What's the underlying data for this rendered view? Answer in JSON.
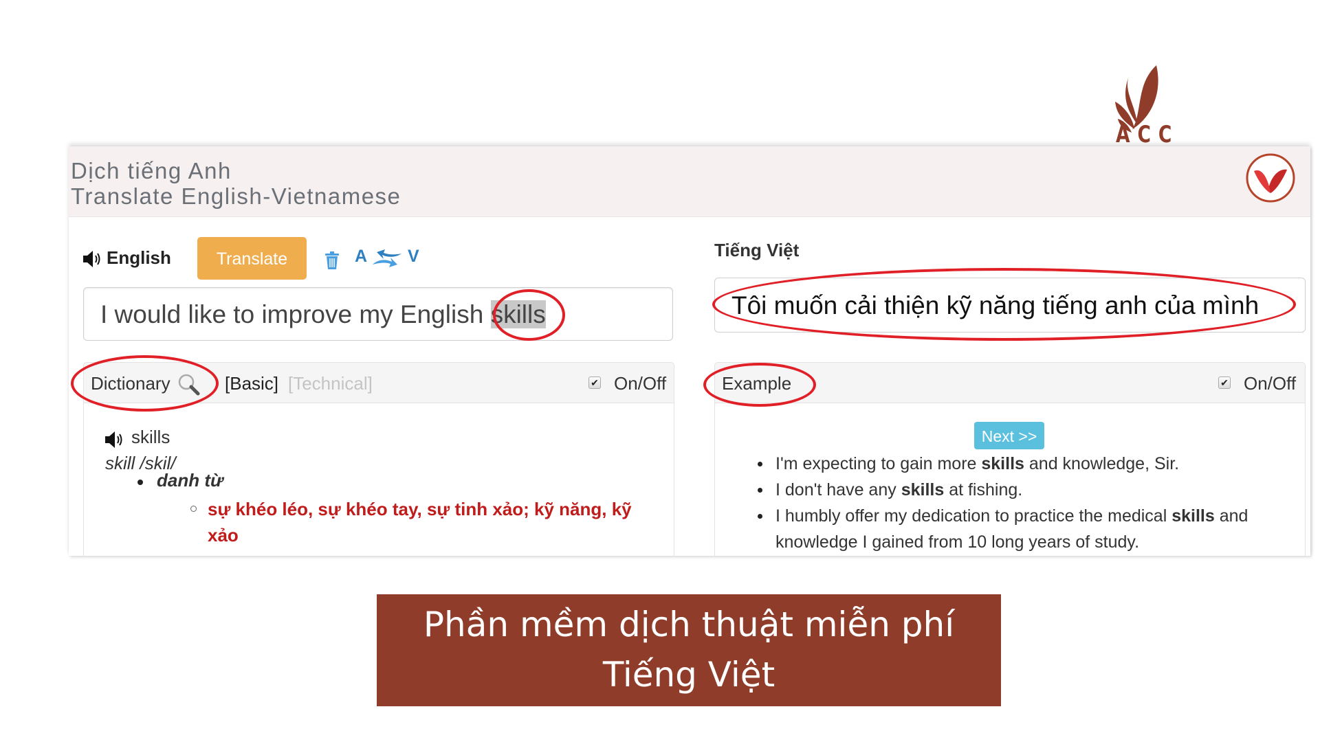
{
  "logo": {
    "text": "ACC",
    "color": "#8f3d2a"
  },
  "app": {
    "title_vi": "Dịch tiếng Anh",
    "title_en": "Translate English-Vietnamese",
    "brand_icon": "v-logo-icon"
  },
  "source": {
    "language_label": "English",
    "speaker_icon": "speaker-icon",
    "translate_button": "Translate",
    "trash_icon": "trash-icon",
    "swap": {
      "from": "A",
      "icon": "swap-arrows-icon",
      "to": "V"
    },
    "input_text_before": "I would like to improve my English ",
    "input_text_highlight": "skills"
  },
  "target": {
    "language_label": "Tiếng Việt",
    "output_text": "Tôi muốn cải thiện kỹ năng tiếng anh của mình"
  },
  "dictionary": {
    "label": "Dictionary",
    "search_icon": "magnifier-icon",
    "tabs": [
      "[Basic]",
      "[Technical]"
    ],
    "active_tab": "[Basic]",
    "toggle_label": "On/Off",
    "toggle_checked": true,
    "word": "skills",
    "phonetic": "skill /skil/",
    "part_of_speech": "danh từ",
    "definition": "sự khéo léo, sự khéo tay, sự tinh xảo; kỹ năng, kỹ xảo"
  },
  "example": {
    "label": "Example",
    "toggle_label": "On/Off",
    "toggle_checked": true,
    "next_button": "Next >>",
    "sentences": [
      {
        "before": "I'm expecting to gain more ",
        "bold": "skills",
        "after": " and knowledge, Sir."
      },
      {
        "before": "I don't have any ",
        "bold": "skills",
        "after": " at fishing."
      },
      {
        "before": "I humbly offer my dedication to practice the medical ",
        "bold": "skills",
        "after": " and knowledge I gained from 10 long years of study."
      }
    ]
  },
  "caption": {
    "line1": "Phần mềm dịch thuật miễn phí",
    "line2": "Tiếng Việt",
    "background": "#8f3d2a"
  },
  "annotation_color": "#e01f26"
}
